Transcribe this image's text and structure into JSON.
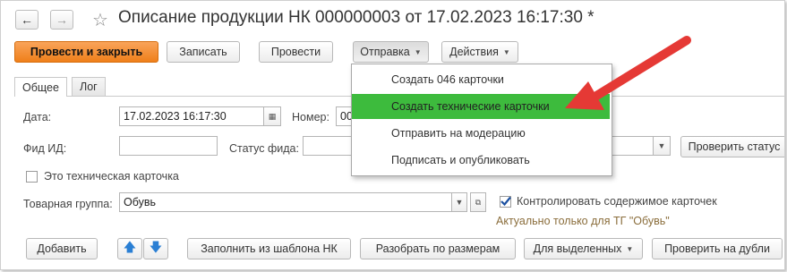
{
  "window": {
    "title": "Описание продукции НК 000000003 от 17.02.2023 16:17:30 *",
    "back_icon": "←",
    "forward_icon": "→",
    "star_icon": "☆"
  },
  "toolbar": {
    "post_close": "Провести и закрыть",
    "save": "Записать",
    "post": "Провести",
    "send": "Отправка",
    "actions": "Действия"
  },
  "tabs": {
    "general": "Общее",
    "log": "Лог"
  },
  "form": {
    "date_label": "Дата:",
    "date_value": "17.02.2023 16:17:30",
    "number_label": "Номер:",
    "number_value": "00",
    "feed_id_label": "Фид ИД:",
    "feed_id_value": "",
    "feed_status_label": "Статус фида:",
    "check_status_button": "Проверить статус",
    "tech_card_label": "Это техническая карточка",
    "product_group_label": "Товарная группа:",
    "product_group_value": "Обувь",
    "control_content_label": "Контролировать содержимое карточек",
    "control_hint": "Актуально только для ТГ \"Обувь\""
  },
  "send_menu": {
    "items": [
      "Создать 046 карточки",
      "Создать технические карточки",
      "Отправить на модерацию",
      "Подписать и опубликовать"
    ],
    "highlight_color": "#3dbb3d"
  },
  "bottom_toolbar": {
    "add": "Добавить",
    "fill_template": "Заполнить из шаблона НК",
    "split_sizes": "Разобрать по размерам",
    "for_selected": "Для выделенных",
    "check_duplicates": "Проверить на дубли"
  },
  "colors": {
    "primary_button": "#ef7f1a",
    "arrow": "#e53935",
    "checkbox_mark": "#1a4fa0"
  }
}
